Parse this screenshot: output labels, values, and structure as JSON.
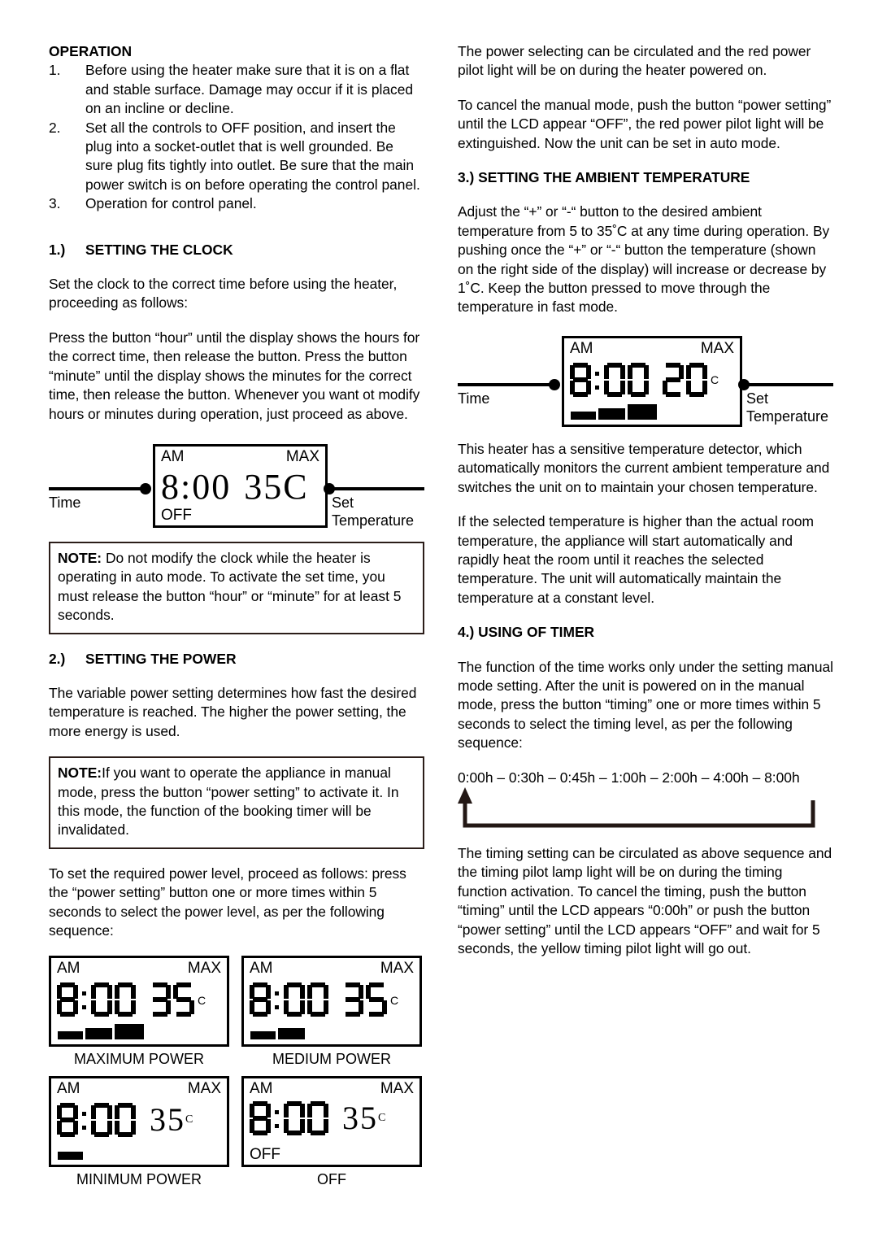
{
  "document": {
    "left_column": {
      "operation_heading": "OPERATION",
      "steps": [
        {
          "num": "1.",
          "text": "Before using the heater make sure that it is on a flat and stable surface. Damage may occur if it is placed on an incline or decline."
        },
        {
          "num": "2.",
          "text": "Set all the controls to OFF position, and insert the plug into a socket-outlet that is well grounded. Be sure plug fits tightly into outlet. Be sure that the main power switch is on before operating the control panel."
        },
        {
          "num": "3.",
          "text": "Operation for control panel."
        }
      ],
      "clock_section": {
        "num": "1.)",
        "title": "SETTING THE CLOCK",
        "para1": "Set the clock to the correct time before using the heater, proceeding as follows:",
        "para2": "Press the button “hour” until the display shows the hours for the correct time, then release the button. Press the button “minute” until the display shows the minutes for the correct time, then release the button. Whenever you want ot modify hours or minutes during operation, just proceed as above."
      },
      "clock_diagram": {
        "label_left": "Time",
        "label_right_line1": "Set",
        "label_right_line2": "Temperature",
        "lcd": {
          "am": "AM",
          "max": "MAX",
          "time": "8:00",
          "temperature": "35",
          "degree_unit": "C",
          "status": "OFF"
        }
      },
      "note_clock": {
        "label": "NOTE:",
        "text": " Do not modify the clock while the heater is operating in auto mode. To activate the set time, you must release the button “hour” or “minute” for at least 5 seconds."
      },
      "power_section": {
        "num": "2.)",
        "title": "SETTING THE POWER",
        "para1": "The variable power setting determines how fast the desired temperature is reached. The higher the power setting, the more energy is used."
      },
      "note_power": {
        "label": "NOTE:",
        "text": "If you want to operate the appliance in manual mode, press the button “power setting” to activate it. In this mode, the function of the booking timer will be invalidated."
      },
      "power_para2": "To set the required power level, proceed as follows: press the “power setting” button one or more times within 5 seconds to select the power level, as per the following sequence:",
      "power_displays": [
        {
          "am": "AM",
          "max": "MAX",
          "time": "8:00",
          "temperature": "35",
          "degree_unit": "C",
          "bars": 3,
          "status": "",
          "caption": "MAXIMUM POWER",
          "digit_style": "segment"
        },
        {
          "am": "AM",
          "max": "MAX",
          "time": "8:00",
          "temperature": "35",
          "degree_unit": "C",
          "bars": 2,
          "status": "",
          "caption": "MEDIUM POWER",
          "digit_style": "segment"
        },
        {
          "am": "AM",
          "max": "MAX",
          "time": "8:00",
          "temperature": "35",
          "degree_unit": "C",
          "bars": 1,
          "status": "",
          "caption": "MINIMUM POWER",
          "digit_style": "serif-temp"
        },
        {
          "am": "AM",
          "max": "MAX",
          "time": "8:00",
          "temperature": "35",
          "degree_unit": "C",
          "bars": 0,
          "status": "OFF",
          "caption": "OFF",
          "digit_style": "serif-temp"
        }
      ]
    },
    "right_column": {
      "para_power_pilot": "The power selecting can be circulated and the red power pilot light will be on during the heater powered on.",
      "para_cancel_manual": "To cancel the manual mode, push the button “power setting” until the LCD appear “OFF”, the red power pilot light will be extinguished. Now the unit can be set in auto mode.",
      "ambient_section": {
        "title": "3.) SETTING THE AMBIENT TEMPERATURE",
        "para1": "Adjust the “+” or “-“ button to the desired ambient temperature from 5 to 35˚C at any time during operation. By pushing once the “+” or “-“ button the temperature (shown on the right side of the display) will increase or decrease by 1˚C.  Keep the button pressed to move through the temperature in fast mode."
      },
      "ambient_diagram": {
        "label_left": "Time",
        "label_right_line1": "Set",
        "label_right_line2": "Temperature",
        "lcd": {
          "am": "AM",
          "max": "MAX",
          "time": "8:00",
          "temperature": "20",
          "degree_unit": "C",
          "bars": 3
        }
      },
      "para_detector": "This heater has a sensitive temperature detector, which automatically monitors the current ambient temperature and switches the unit on to maintain your chosen temperature.",
      "para_selected_temp": "If the selected temperature is higher than the actual room temperature, the appliance will start automatically and rapidly heat the room until it reaches the selected temperature. The unit will automatically maintain the temperature at a constant level.",
      "timer_section": {
        "title": "4.) USING OF TIMER",
        "para1": "The function of the time works only under the setting manual mode setting. After the unit is powered on in the manual mode, press the button “timing” one or more times within 5 seconds to select the timing level, as per the following sequence:",
        "sequence": "0:00h – 0:30h – 0:45h – 1:00h – 2:00h – 4:00h – 8:00h",
        "para2": "The timing setting can be circulated as above sequence and the timing pilot lamp light will be on during the timing function activation. To cancel the timing, push the button “timing” until the LCD appears “0:00h” or push the button “power setting” until the LCD appears “OFF” and wait for 5 seconds, the yellow timing pilot light will go out."
      }
    }
  }
}
